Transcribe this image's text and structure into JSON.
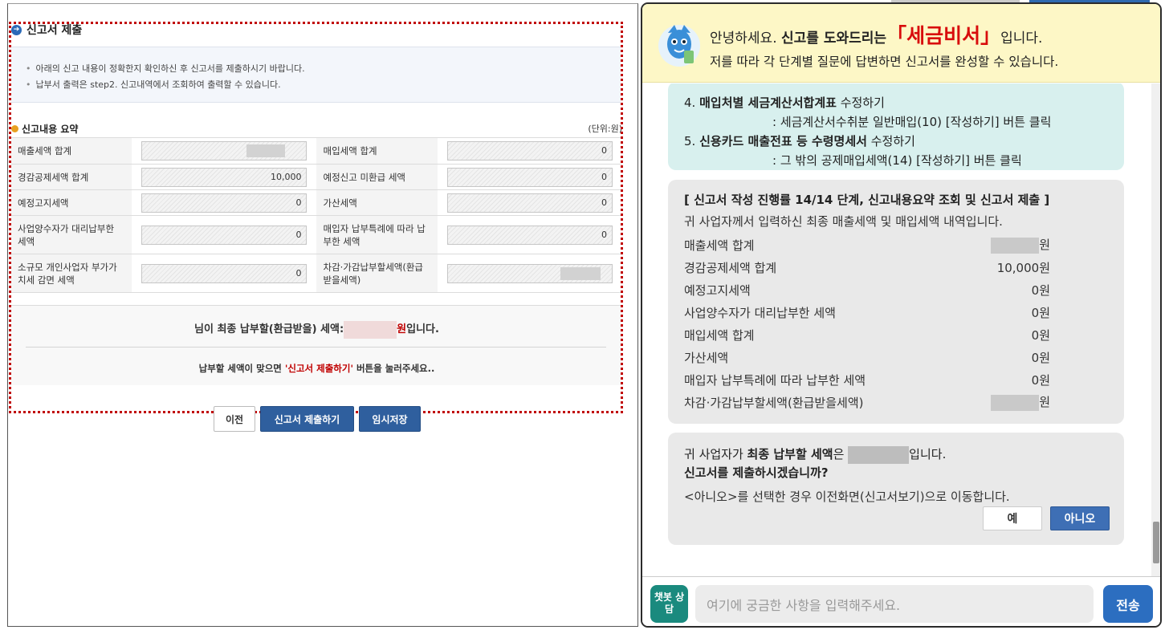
{
  "form": {
    "title": "신고서 제출",
    "notices": [
      "아래의 신고 내용이 정확한지 확인하신 후 신고서를 제출하시기 바랍니다.",
      "납부서 출력은 step2. 신고내역에서 조회하여 출력할 수 있습니다."
    ],
    "summary_title": "신고내용 요약",
    "unit": "(단위:원)",
    "rows": [
      {
        "l1": "매출세액 합계",
        "v1": "",
        "l2": "매입세액 합계",
        "v2": "0"
      },
      {
        "l1": "경감공제세액 합계",
        "v1": "10,000",
        "l2": "예정신고 미환급 세액",
        "v2": "0"
      },
      {
        "l1": "예정고지세액",
        "v1": "0",
        "l2": "가산세액",
        "v2": "0"
      },
      {
        "l1": "사업양수자가 대리납부한 세액",
        "v1": "0",
        "l2": "매입자 납부특례에 따라 납부한 세액",
        "v2": "0"
      },
      {
        "l1": "소규모 개인사업자 부가가치세 감면 세액",
        "v1": "0",
        "l2": "차감·가감납부할세액(환급받을세액)",
        "v2": ""
      }
    ],
    "final_prefix": "님이 최종 납부할(환급받을) 세액:",
    "final_won": "원",
    "final_suffix": "입니다.",
    "press_prefix": "납부할 세액이 맞으면 ",
    "press_highlight": "'신고서 제출하기'",
    "press_suffix": " 버튼을 눌러주세요..",
    "btn_prev": "이전",
    "btn_submit": "신고서 제출하기",
    "btn_save": "임시저장"
  },
  "chat": {
    "greet_a": "안녕하세요. ",
    "greet_b": "신고를 도와드리는",
    "brand": "「세금비서」",
    "greet_c": "입니다.",
    "greet_2": "저를 따라 각 단계별 질문에 답변하면 신고서를 완성할 수 있습니다.",
    "step4_num": "4. ",
    "step4_bold": "매입처별 세금계산서합계표",
    "step4_rest": " 수정하기",
    "step4_sub": ": 세금계산서수취분 일반매입(10) [작성하기] 버튼 클릭",
    "step5_num": "5. ",
    "step5_bold": "신용카드 매출전표 등 수령명세서",
    "step5_rest": " 수정하기",
    "step5_sub": ": 그 밖의 공제매입세액(14) [작성하기] 버튼 클릭",
    "summary_title": "[ 신고서 작성 진행률 14/14 단계, 신고내용요약 조회 및 신고서 제출 ]",
    "summary_intro": "귀 사업자께서 입력하신 최종 매출세액 및 매입세액 내역입니다.",
    "items": [
      {
        "label": "매출세액 합계",
        "value": "",
        "won": "원"
      },
      {
        "label": "경감공제세액 합계",
        "value": "10,000",
        "won": "원"
      },
      {
        "label": "예정고지세액",
        "value": "0",
        "won": "원"
      },
      {
        "label": "사업양수자가 대리납부한 세액",
        "value": "0",
        "won": "원"
      },
      {
        "label": "매입세액 합계",
        "value": "0",
        "won": "원"
      },
      {
        "label": "가산세액",
        "value": "0",
        "won": "원"
      },
      {
        "label": "매입자 납부특례에 따라 납부한 세액",
        "value": "0",
        "won": "원"
      },
      {
        "label": "차감·가감납부할세액(환급받을세액)",
        "value": "",
        "won": "원"
      }
    ],
    "q_prefix": "귀 사업자가 ",
    "q_bold": "최종 납부할 세액",
    "q_mid": "은 ",
    "q_suffix": "입니다.",
    "q_line2": "신고서를 제출하시겠습니까?",
    "q_note": "<아니오>를 선택한 경우 이전화면(신고서보기)으로 이동합니다.",
    "btn_yes": "예",
    "btn_no": "아니오",
    "chat_icon": "챗봇 상담",
    "input_placeholder": "여기에 궁금한 사항을 입력해주세요.",
    "send": "전송"
  }
}
